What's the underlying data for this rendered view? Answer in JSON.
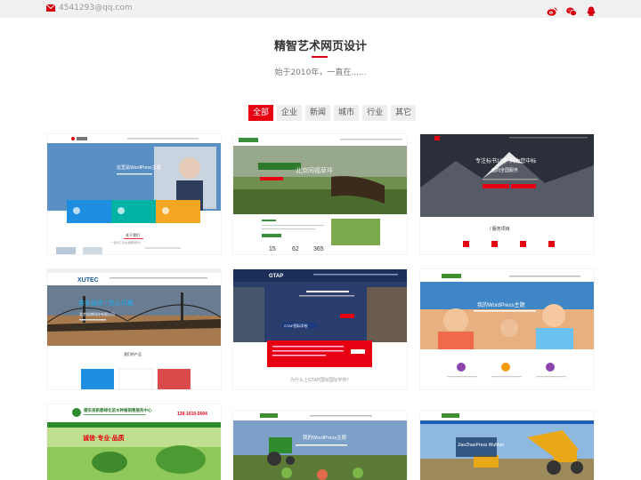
{
  "topbar": {
    "email": "4541293@qq.com",
    "social": [
      {
        "icon": "weibo-icon"
      },
      {
        "icon": "wechat-icon"
      },
      {
        "icon": "qq-icon"
      }
    ]
  },
  "section": {
    "title": "精智艺术网页设计",
    "subtitle": "始于2010年，一直在......"
  },
  "filters": [
    {
      "label": "全部",
      "active": true
    },
    {
      "label": "企业"
    },
    {
      "label": "新闻"
    },
    {
      "label": "城市"
    },
    {
      "label": "行业"
    },
    {
      "label": "其它"
    }
  ],
  "portfolio": {
    "t1": {
      "hero": "这里是WordPress主题",
      "cta": "关于我们",
      "tagline": "一起为了企业发展而努力"
    },
    "t2": {
      "hero": "北京同福草坪",
      "stats": [
        "15",
        "62",
        "365"
      ]
    },
    "t3": {
      "hero": "专注标书10年 只为您中标",
      "sub": "面向全国服务",
      "section": "/ 服务项目"
    },
    "t4": {
      "logo": "XUTEC",
      "hero": "务实诚信 | 信心共赢",
      "company": "北京旭博科技有限公司",
      "section": "我们的产品"
    },
    "t5": {
      "logo": "GTAP",
      "banner": "GTAP国际学校",
      "question": "为什么上GTAP国际国际学校？"
    },
    "t6": {
      "hero": "我的WordPress主题"
    },
    "t7": {
      "company": "德安县新都绿化苗木种植销售服务中心",
      "phone": "139-1010-5004",
      "slogan": "诚信·专业·品质"
    },
    "t8": {
      "hero": "我的WordPress主题"
    },
    "t9": {
      "hero": "JianZhanPress WuMao"
    }
  },
  "colors": {
    "accent": "#e60012"
  }
}
